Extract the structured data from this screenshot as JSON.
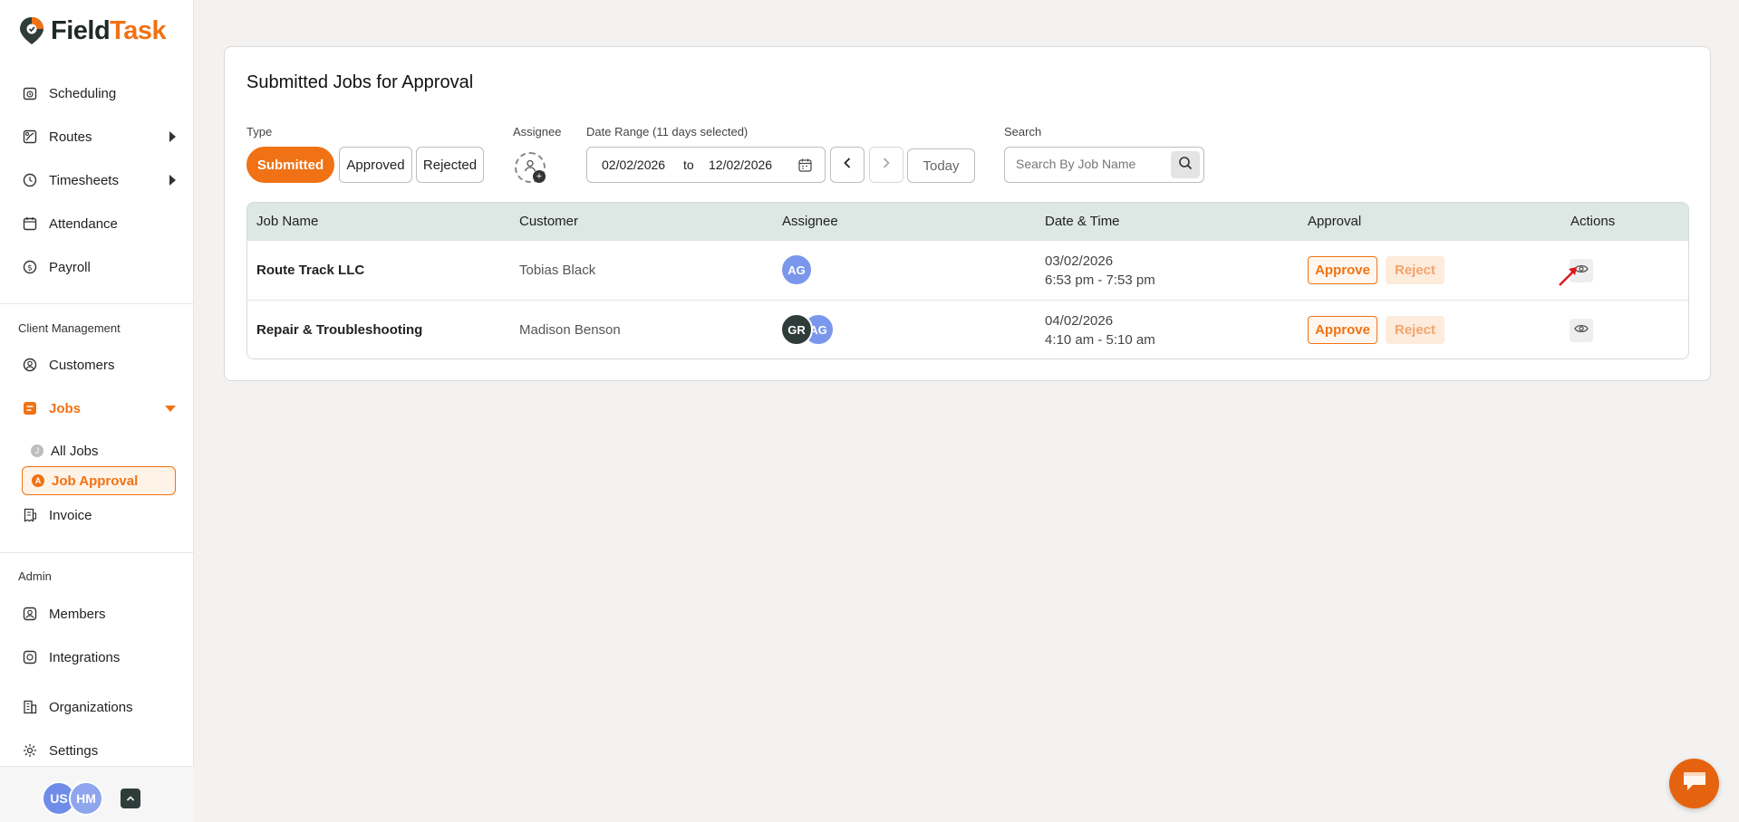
{
  "app": {
    "logo_part1": "Field",
    "logo_part2": "Task",
    "brand_color": "#f07214"
  },
  "sidebar": {
    "main_items": [
      {
        "label": "Scheduling",
        "icon": "calendar-clock-icon"
      },
      {
        "label": "Routes",
        "icon": "map-route-icon"
      },
      {
        "label": "Timesheets",
        "icon": "clock-icon"
      },
      {
        "label": "Attendance",
        "icon": "calendar-check-icon"
      },
      {
        "label": "Payroll",
        "icon": "dollar-icon"
      }
    ],
    "client_section": "Client Management",
    "customers": "Customers",
    "jobs": "Jobs",
    "all_jobs": "All Jobs",
    "all_jobs_badge": "J",
    "job_approval": "Job Approval",
    "job_approval_badge": "A",
    "invoice": "Invoice",
    "admin_section": "Admin",
    "members": "Members",
    "integrations": "Integrations",
    "organizations": "Organizations",
    "settings": "Settings",
    "user_avatars": [
      "US",
      "HM"
    ]
  },
  "page": {
    "title": "Submitted Jobs for Approval"
  },
  "filters": {
    "type_label": "Type",
    "type_options": [
      "Submitted",
      "Approved",
      "Rejected"
    ],
    "type_selected": "Submitted",
    "assignee_label": "Assignee",
    "date_range_label": "Date Range (11 days selected)",
    "date_from": "02/02/2026",
    "date_to_word": "to",
    "date_to": "12/02/2026",
    "today_label": "Today",
    "search_label": "Search",
    "search_placeholder": "Search By Job Name",
    "search_value": ""
  },
  "table": {
    "columns": [
      "Job Name",
      "Customer",
      "Assignee",
      "Date & Time",
      "Approval",
      "Actions"
    ],
    "rows": [
      {
        "job_name": "Route Track LLC",
        "customer": "Tobias Black",
        "assignees": [
          {
            "initials": "AG",
            "color": "#7b97ec"
          }
        ],
        "date": "03/02/2026",
        "time": "6:53 pm - 7:53 pm",
        "approve": "Approve",
        "reject": "Reject"
      },
      {
        "job_name": "Repair & Troubleshooting",
        "customer": "Madison Benson",
        "assignees": [
          {
            "initials": "GR",
            "color": "#2f3d3a"
          },
          {
            "initials": "AG",
            "color": "#7b97ec"
          }
        ],
        "date": "04/02/2026",
        "time": "4:10 am - 5:10 am",
        "approve": "Approve",
        "reject": "Reject"
      }
    ]
  }
}
